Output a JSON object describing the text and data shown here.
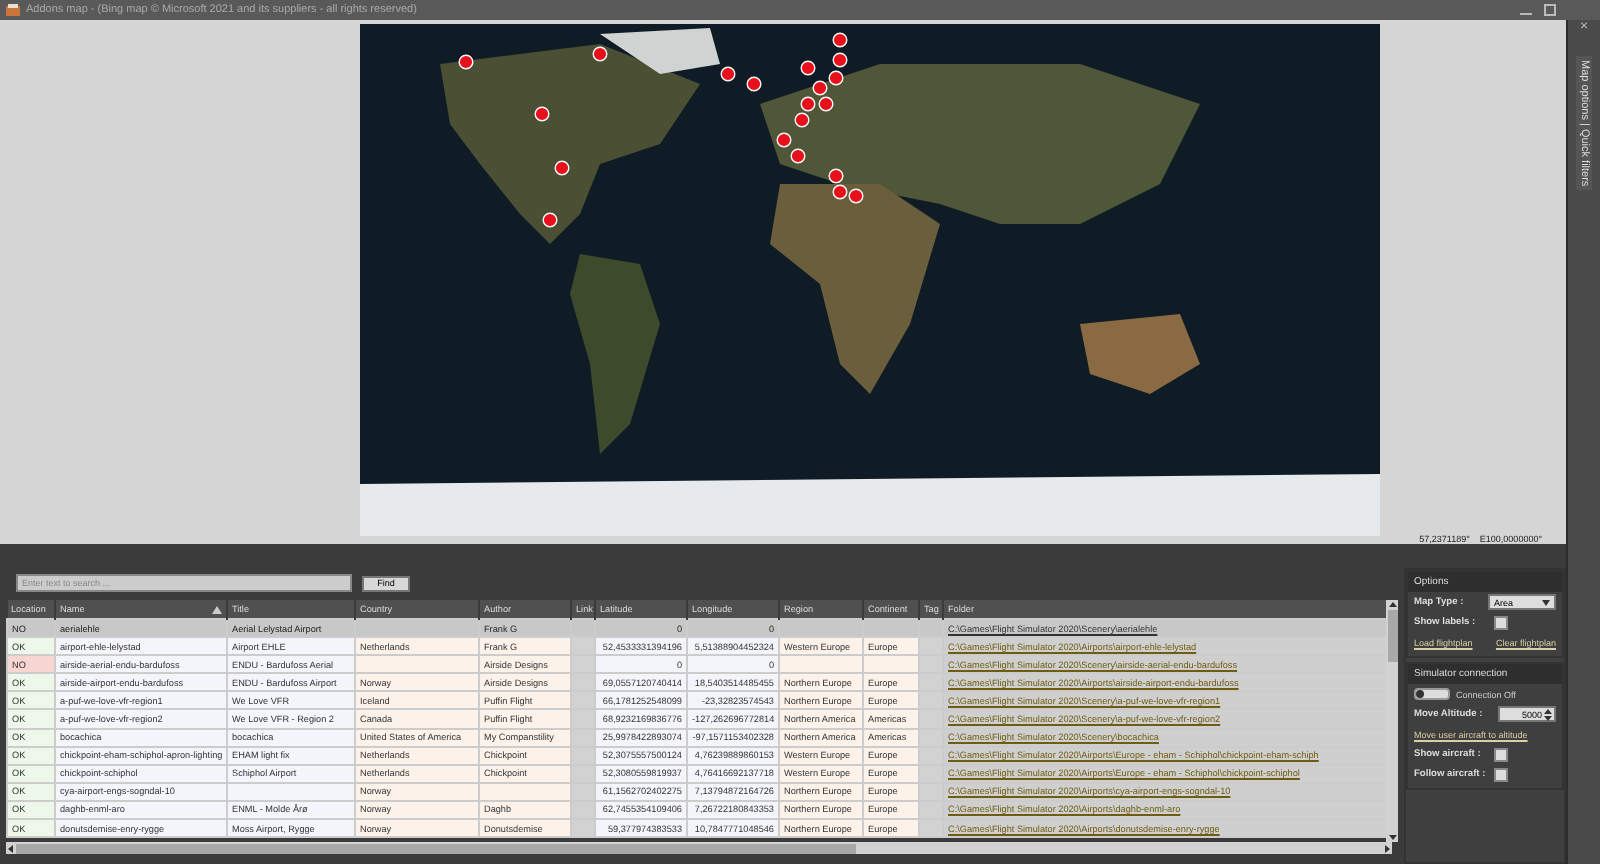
{
  "window": {
    "title": "Addons map - (Bing map © Microsoft 2021 and its suppliers - all rights reserved)"
  },
  "side_strip": {
    "close": "×",
    "label": "Map options | Quick filters"
  },
  "map": {
    "latitude": "57,2371189°",
    "longitude": "E100,0000000°"
  },
  "search": {
    "placeholder": "Enter text to search ...",
    "button": "Find"
  },
  "table": {
    "columns": [
      {
        "label": "Location",
        "sorted": false
      },
      {
        "label": "Name",
        "sorted": true
      },
      {
        "label": "Title",
        "sorted": false
      },
      {
        "label": "Country",
        "sorted": false
      },
      {
        "label": "Author",
        "sorted": false
      },
      {
        "label": "Link",
        "sorted": false
      },
      {
        "label": "Latitude",
        "sorted": false
      },
      {
        "label": "Longitude",
        "sorted": false
      },
      {
        "label": "Region",
        "sorted": false
      },
      {
        "label": "Continent",
        "sorted": false
      },
      {
        "label": "Tag",
        "sorted": false
      },
      {
        "label": "Folder",
        "sorted": false
      }
    ],
    "rows": [
      {
        "selected": true,
        "valid": false,
        "cells": [
          "NO",
          "aerialehle",
          "Aerial Lelystad Airport",
          "",
          "Frank G",
          "",
          "0",
          "0",
          "",
          "",
          "",
          "C:\\Games\\Flight Simulator 2020\\Scenery\\aerialehle"
        ]
      },
      {
        "selected": false,
        "valid": true,
        "cells": [
          "OK",
          "airport-ehle-lelystad",
          "Airport EHLE",
          "Netherlands",
          "Frank G",
          "",
          "52,4533331394196",
          "5,51388904452324",
          "Western Europe",
          "Europe",
          "",
          "C:\\Games\\Flight Simulator 2020\\Airports\\airport-ehle-lelystad"
        ]
      },
      {
        "selected": false,
        "valid": false,
        "cells": [
          "NO",
          "airside-aerial-endu-bardufoss",
          "ENDU - Bardufoss Aerial",
          "",
          "Airside Designs",
          "",
          "0",
          "0",
          "",
          "",
          "",
          "C:\\Games\\Flight Simulator 2020\\Scenery\\airside-aerial-endu-bardufoss"
        ]
      },
      {
        "selected": false,
        "valid": true,
        "cells": [
          "OK",
          "airside-airport-endu-bardufoss",
          "ENDU - Bardufoss Airport",
          "Norway",
          "Airside Designs",
          "",
          "69,0557120740414",
          "18,5403514485455",
          "Northern Europe",
          "Europe",
          "",
          "C:\\Games\\Flight Simulator 2020\\Airports\\airside-airport-endu-bardufoss"
        ]
      },
      {
        "selected": false,
        "valid": true,
        "cells": [
          "OK",
          "a-puf-we-love-vfr-region1",
          "We Love VFR",
          "Iceland",
          "Puffin Flight",
          "",
          "66,1781252548099",
          "-23,32823574543",
          "Northern Europe",
          "Europe",
          "",
          "C:\\Games\\Flight Simulator 2020\\Scenery\\a-puf-we-love-vfr-region1"
        ]
      },
      {
        "selected": false,
        "valid": true,
        "cells": [
          "OK",
          "a-puf-we-love-vfr-region2",
          "We Love VFR - Region 2",
          "Canada",
          "Puffin Flight",
          "",
          "68,9232169836776",
          "-127,262696772814",
          "Northern America",
          "Americas",
          "",
          "C:\\Games\\Flight Simulator 2020\\Scenery\\a-puf-we-love-vfr-region2"
        ]
      },
      {
        "selected": false,
        "valid": true,
        "cells": [
          "OK",
          "bocachica",
          "bocachica",
          "United States of America",
          "My Companstility",
          "",
          "25,9978422893074",
          "-97,1571153402328",
          "Northern America",
          "Americas",
          "",
          "C:\\Games\\Flight Simulator 2020\\Scenery\\bocachica"
        ]
      },
      {
        "selected": false,
        "valid": true,
        "cells": [
          "OK",
          "chickpoint-eham-schiphol-apron-lighting",
          "EHAM light fix",
          "Netherlands",
          "Chickpoint",
          "",
          "52,3075557500124",
          "4,76239889860153",
          "Western Europe",
          "Europe",
          "",
          "C:\\Games\\Flight Simulator 2020\\Airports\\Europe - eham - Schiphol\\chickpoint-eham-schiph"
        ]
      },
      {
        "selected": false,
        "valid": true,
        "cells": [
          "OK",
          "chickpoint-schiphol",
          "Schiphol Airport",
          "Netherlands",
          "Chickpoint",
          "",
          "52,3080559819937",
          "4,76416692137718",
          "Western Europe",
          "Europe",
          "",
          "C:\\Games\\Flight Simulator 2020\\Airports\\Europe - eham - Schiphol\\chickpoint-schiphol"
        ]
      },
      {
        "selected": false,
        "valid": true,
        "cells": [
          "OK",
          "cya-airport-engs-sogndal-10",
          "",
          "Norway",
          "",
          "",
          "61,1562702402275",
          "7,13794872164726",
          "Northern Europe",
          "Europe",
          "",
          "C:\\Games\\Flight Simulator 2020\\Airports\\cya-airport-engs-sogndal-10"
        ]
      },
      {
        "selected": false,
        "valid": true,
        "cells": [
          "OK",
          "daghb-enml-aro",
          "ENML - Molde Årø",
          "Norway",
          "Daghb",
          "",
          "62,7455354109406",
          "7,26722180843353",
          "Northern Europe",
          "Europe",
          "",
          "C:\\Games\\Flight Simulator 2020\\Airports\\daghb-enml-aro"
        ]
      },
      {
        "selected": false,
        "valid": true,
        "cells": [
          "OK",
          "donutsdemise-enry-rygge",
          "Moss Airport, Rygge",
          "Norway",
          "Donutsdemise",
          "",
          "59,377974383533",
          "10,7847771048546",
          "Northern Europe",
          "Europe",
          "",
          "C:\\Games\\Flight Simulator 2020\\Airports\\donutsdemise-enry-rygge"
        ]
      }
    ]
  },
  "options": {
    "title": "Options",
    "map_type": {
      "label": "Map Type :",
      "value": "Area"
    },
    "show_labels": {
      "label": "Show labels :",
      "checked": false
    },
    "links": [
      "Load flightplan",
      "Clear flightplan"
    ]
  },
  "simulator": {
    "title": "Simulator connection",
    "connection": {
      "label": "Connection Off",
      "on": false
    },
    "altitude": {
      "label": "Move Altitude :",
      "value": "5000"
    },
    "move_link": "Move user aircraft to altitude",
    "toggles": [
      {
        "label": "Show aircraft :",
        "checked": false
      },
      {
        "label": "Follow aircraft :",
        "checked": false
      }
    ]
  }
}
